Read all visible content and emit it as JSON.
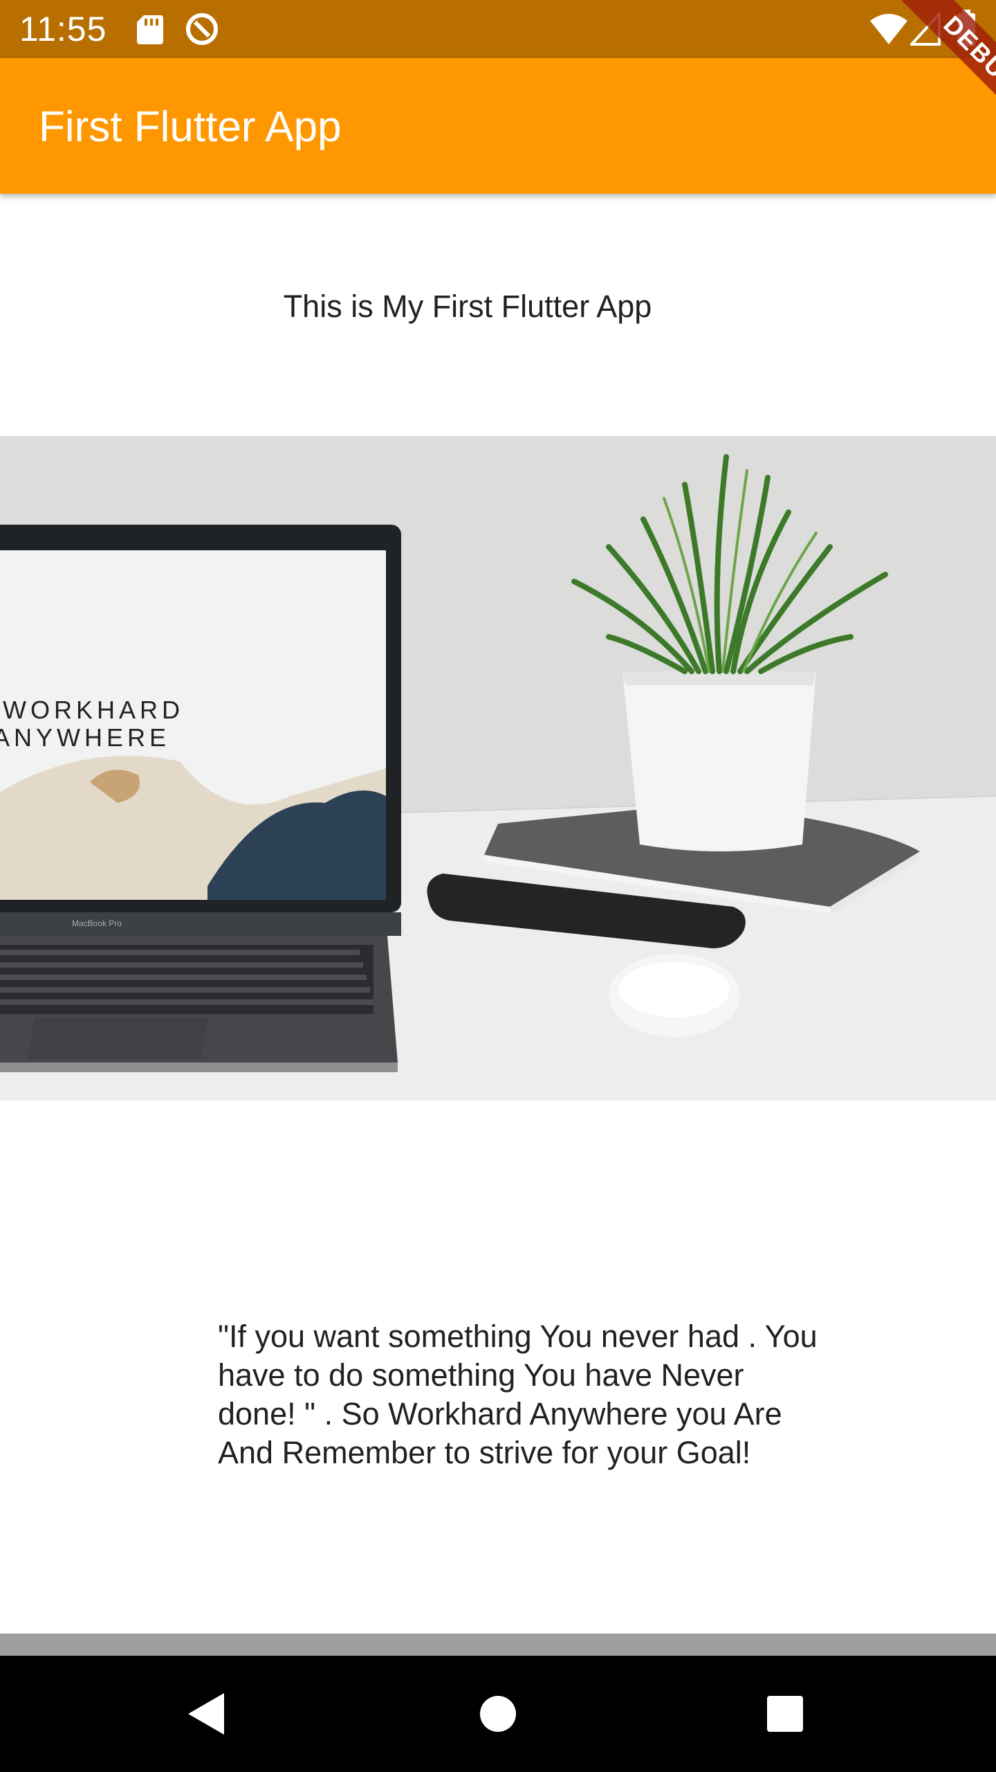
{
  "status_bar": {
    "time": "11:55",
    "icons": [
      "sd-card-icon",
      "data-saver-icon",
      "wifi-icon",
      "signal-icon",
      "battery-icon"
    ]
  },
  "app_bar": {
    "title": "First Flutter App",
    "background_color": "#ff9800"
  },
  "debug_banner": {
    "label": "DEBUG"
  },
  "main": {
    "intro_text": "This is My First Flutter App",
    "image_screen_text_line1": "WORKHARD",
    "image_screen_text_line2": "ANYWHERE",
    "image_laptop_label": "MacBook Pro",
    "quote": "\"If you want something You never had . You have to do something You have Never done! \" . So Workhard Anywhere you Are And Remember to strive for your Goal!"
  },
  "navigation_bar": {
    "buttons": [
      "back-icon",
      "home-icon",
      "recents-icon"
    ]
  }
}
